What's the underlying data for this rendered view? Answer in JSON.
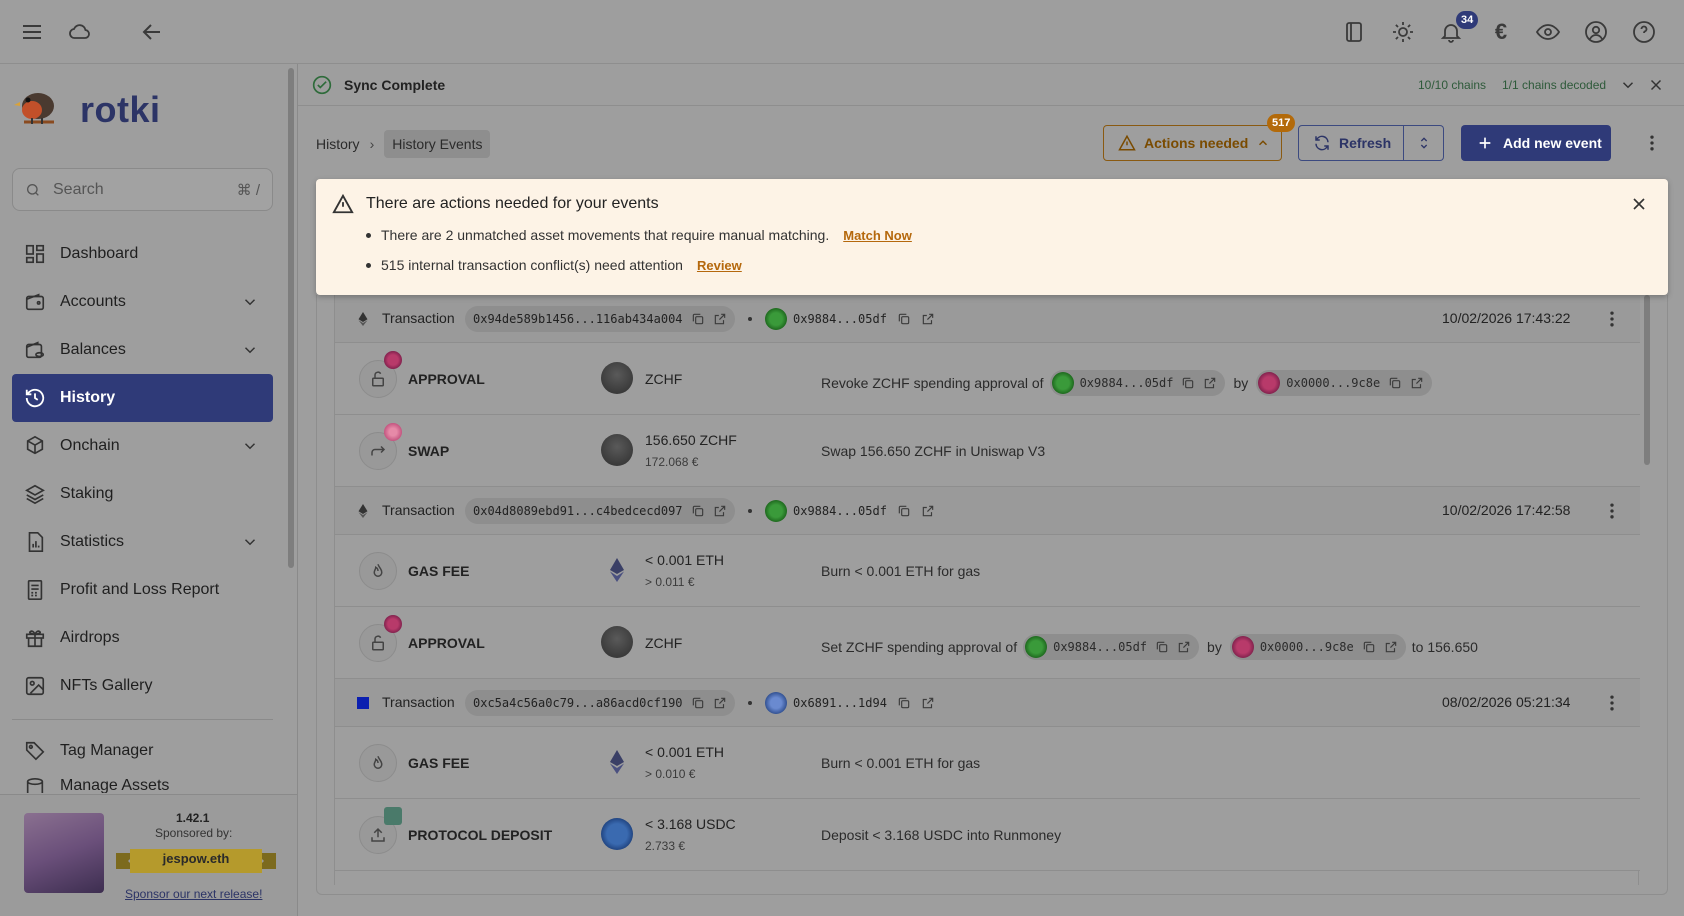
{
  "app": {
    "name": "rotki"
  },
  "appbar": {
    "notifications_count": "34",
    "currency_symbol": "€"
  },
  "sidebar": {
    "search_placeholder": "Search",
    "search_shortcut": "⌘ /",
    "items": [
      {
        "label": "Dashboard",
        "icon": "dashboard-icon",
        "expandable": false
      },
      {
        "label": "Accounts",
        "icon": "wallet-icon",
        "expandable": true
      },
      {
        "label": "Balances",
        "icon": "balances-icon",
        "expandable": true
      },
      {
        "label": "History",
        "icon": "history-icon",
        "expandable": false,
        "active": true
      },
      {
        "label": "Onchain",
        "icon": "onchain-icon",
        "expandable": true
      },
      {
        "label": "Staking",
        "icon": "staking-icon",
        "expandable": false
      },
      {
        "label": "Statistics",
        "icon": "statistics-icon",
        "expandable": true
      },
      {
        "label": "Profit and Loss Report",
        "icon": "report-icon",
        "expandable": false
      },
      {
        "label": "Airdrops",
        "icon": "gift-icon",
        "expandable": false
      },
      {
        "label": "NFTs Gallery",
        "icon": "image-icon",
        "expandable": false
      },
      {
        "label": "Tag Manager",
        "icon": "tag-icon",
        "expandable": false
      }
    ],
    "partial_item": "Manage Assets",
    "sponsor": {
      "version": "1.42.1",
      "sponsored_by": "Sponsored by:",
      "sponsor_name": "jespow.eth",
      "link": "Sponsor our next release!"
    }
  },
  "sync": {
    "title": "Sync Complete",
    "chains": "10/10 chains",
    "decoded": "1/1 chains decoded"
  },
  "breadcrumb": {
    "root": "History",
    "current": "History Events"
  },
  "toolbar": {
    "actions_label": "Actions needed",
    "actions_badge": "517",
    "refresh_label": "Refresh",
    "add_label": "Add new event"
  },
  "alert": {
    "title": "There are actions needed for your events",
    "items": [
      {
        "text": "There are 2 unmatched asset movements that require manual matching.",
        "link": "Match Now"
      },
      {
        "text": "515 internal transaction conflict(s) need attention",
        "link": "Review"
      }
    ]
  },
  "transactions": [
    {
      "label": "Transaction",
      "hash": "0x94de589b1456...116ab434a004",
      "address": "0x9884...05df",
      "time": "10/02/2026 17:43:22",
      "events": [
        {
          "type": "APPROVAL",
          "asset_main": "ZCHF",
          "asset_sub": "",
          "desc": [
            "Revoke ZCHF spending approval of",
            "0x9884...05df",
            "by",
            "0x0000...9c8e"
          ]
        },
        {
          "type": "SWAP",
          "asset_main": "156.650 ZCHF",
          "asset_sub": "172.068 €",
          "desc": [
            "Swap 156.650 ZCHF in Uniswap V3"
          ]
        }
      ]
    },
    {
      "label": "Transaction",
      "hash": "0x04d8089ebd91...c4bedcecd097",
      "address": "0x9884...05df",
      "time": "10/02/2026 17:42:58",
      "events": [
        {
          "type": "GAS FEE",
          "asset_main": "< 0.001 ETH",
          "asset_sub": "> 0.011 €",
          "desc": [
            "Burn < 0.001 ETH for gas"
          ]
        },
        {
          "type": "APPROVAL",
          "asset_main": "ZCHF",
          "asset_sub": "",
          "desc": [
            "Set ZCHF spending approval of",
            "0x9884...05df",
            "by",
            "0x0000...9c8e",
            "to 156.650"
          ]
        }
      ]
    },
    {
      "label": "Transaction",
      "hash": "0xc5a4c56a0c79...a86acd0cf190",
      "address": "0x6891...1d94",
      "time": "08/02/2026 05:21:34",
      "events": [
        {
          "type": "GAS FEE",
          "asset_main": "< 0.001 ETH",
          "asset_sub": "> 0.010 €",
          "desc": [
            "Burn < 0.001 ETH for gas"
          ]
        },
        {
          "type": "PROTOCOL DEPOSIT",
          "asset_main": "< 3.168 USDC",
          "asset_sub": "2.733 €",
          "desc": [
            "Deposit < 3.168 USDC into Runmoney"
          ]
        }
      ]
    }
  ],
  "colors": {
    "accent": "#2f3a78",
    "warning": "#b5680c",
    "success": "#2e6b3a"
  }
}
